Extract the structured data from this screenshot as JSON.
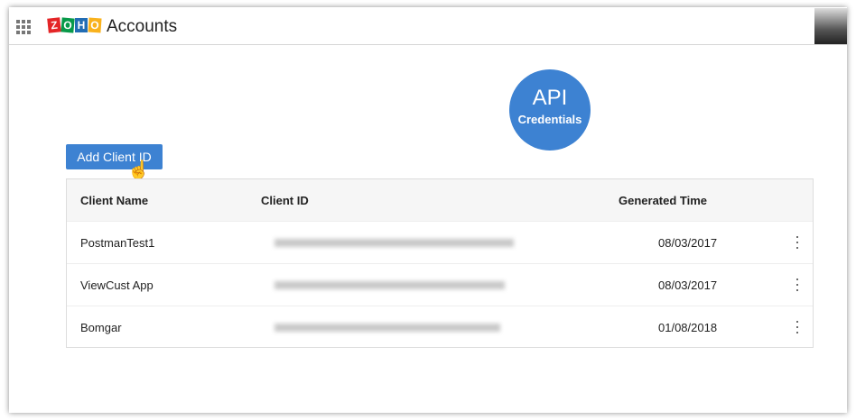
{
  "header": {
    "logo_text": "ZOHO",
    "title": "Accounts"
  },
  "badge": {
    "line1": "API",
    "line2": "Credentials"
  },
  "add_button": "Add Client ID",
  "table": {
    "columns": [
      "Client Name",
      "Client ID",
      "Generated Time"
    ],
    "rows": [
      {
        "name": "PostmanTest1",
        "date": "08/03/2017"
      },
      {
        "name": "ViewCust App",
        "date": "08/03/2017"
      },
      {
        "name": "Bomgar",
        "date": "01/08/2018"
      }
    ]
  },
  "colors": {
    "accent": "#3d82d2"
  }
}
